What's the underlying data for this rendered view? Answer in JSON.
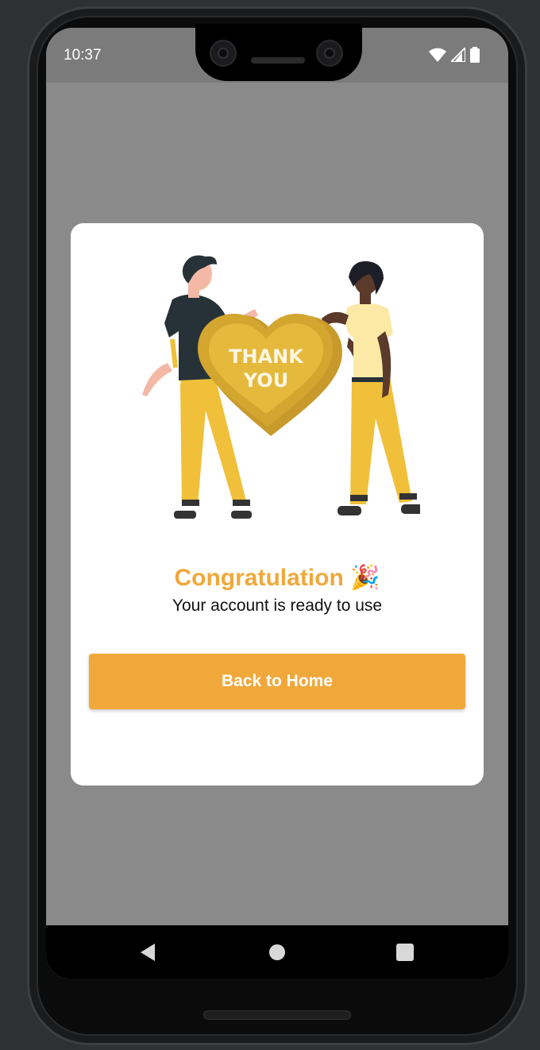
{
  "status_bar": {
    "time": "10:37",
    "icons": [
      "wifi-icon",
      "signal-icon",
      "battery-icon"
    ]
  },
  "dialog": {
    "illustration_text": "THANK YOU",
    "title": "Congratulation",
    "title_emoji": "🎉",
    "subtitle": "Your account is ready to use",
    "button_label": "Back to Home"
  },
  "nav_bar": {
    "icons": [
      "back-icon",
      "home-icon",
      "recents-icon"
    ]
  },
  "colors": {
    "accent": "#f0a83b",
    "heart": "#d3a62f",
    "overlay": "#8a8a8a"
  }
}
